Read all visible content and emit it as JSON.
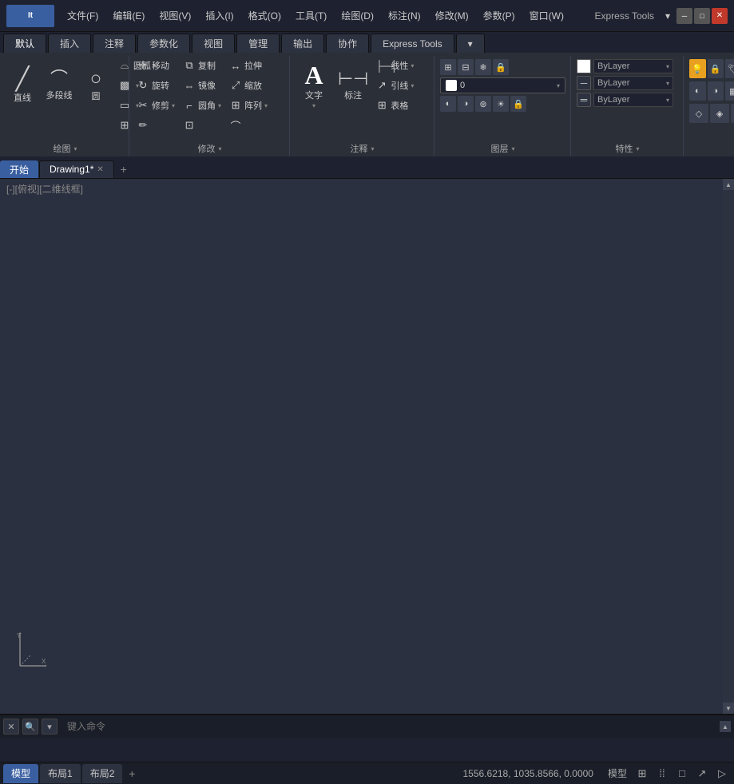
{
  "titlebar": {
    "logo": "It",
    "menus": [
      "文件(F)",
      "编辑(E)",
      "视图(V)",
      "插入(I)",
      "格式(O)",
      "工具(T)",
      "绘图(D)",
      "标注(N)",
      "修改(M)",
      "参数(P)",
      "窗口(W)"
    ],
    "express_tools": "Express Tools",
    "extra": "▾"
  },
  "ribbon": {
    "tabs": [
      "默认",
      "插入",
      "注释",
      "参数化",
      "视图",
      "管理",
      "输出",
      "协作",
      "Express Tools",
      "▾"
    ],
    "groups": {
      "draw": {
        "label": "绘图",
        "tools_large": [
          "直线",
          "多段线",
          "圆"
        ],
        "tools_small": [
          "圆弧"
        ]
      },
      "modify": {
        "label": "修改",
        "tools": [
          "移动",
          "旋转",
          "修剪",
          "复制",
          "镜像",
          "圆角",
          "拉伸",
          "缩放",
          "阵列"
        ]
      },
      "annotate": {
        "label": "注释",
        "tools": [
          "文字",
          "标注",
          "线性",
          "引线",
          "表格"
        ]
      },
      "layers": {
        "label": "图层",
        "dropdown": "0",
        "icons": [
          "🔆",
          "🔒",
          "❄",
          "🔗"
        ]
      },
      "properties": {
        "label": "特性",
        "color": "ByLayer",
        "linetype": "ByLayer",
        "lineweight": "ByLayer"
      }
    }
  },
  "drawing_tabs": {
    "tabs": [
      {
        "label": "开始",
        "active": false,
        "closeable": false
      },
      {
        "label": "Drawing1*",
        "active": true,
        "closeable": true
      }
    ],
    "add_btn": "+"
  },
  "viewport": {
    "label": "[-][俯视][二维线框]"
  },
  "command_line": {
    "placeholder": "键入命令",
    "output": ""
  },
  "status_bar": {
    "tabs": [
      {
        "label": "模型",
        "active": true
      },
      {
        "label": "布局1",
        "active": false
      },
      {
        "label": "布局2",
        "active": false
      }
    ],
    "add_btn": "+",
    "coordinates": "1556.6218, 1035.8566, 0.0000",
    "mode_label": "模型",
    "icons": [
      "⊞",
      "⁞⁞⁞",
      "□",
      "↗",
      "▷"
    ]
  },
  "scrollbar": {
    "up_arrow": "▲",
    "down_arrow": "▼"
  }
}
